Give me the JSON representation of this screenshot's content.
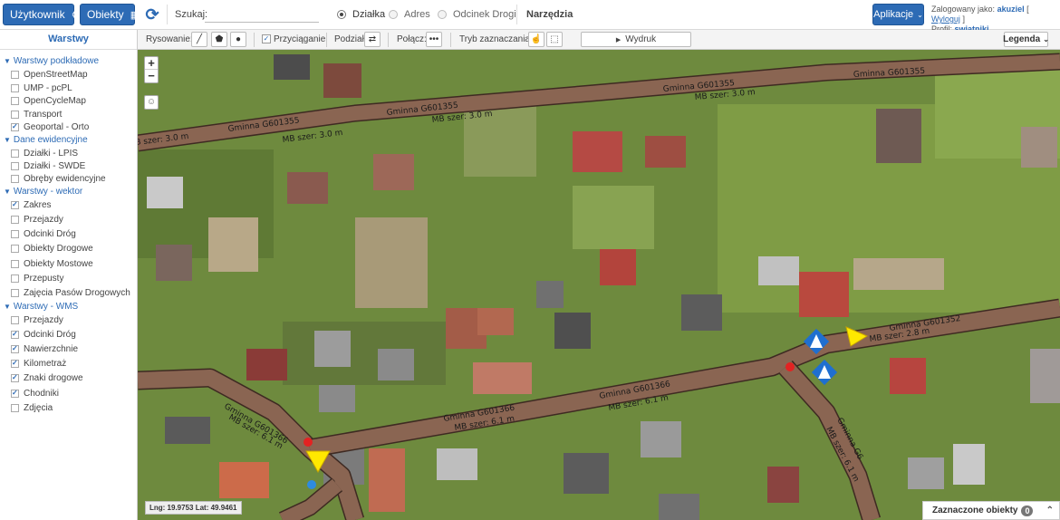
{
  "topbar": {
    "user_button": "Użytkownik",
    "objects_button": "Obiekty",
    "search_label": "Szukaj:",
    "search_value": "",
    "search_placeholder": "",
    "radio_options": [
      "Działka",
      "Adres",
      "Odcinek Drogi"
    ],
    "radio_selected": "Działka",
    "tools_label": "Narzędzia",
    "apps_button": "Aplikacje",
    "logged_in_label": "Zalogowany jako:",
    "username": "akuziel",
    "logout_link": "Wyloguj",
    "profile_label": "Profil:",
    "profile_name": "swiatniki"
  },
  "toolbar": {
    "drawing_label": "Rysowanie:",
    "snapping_label": "Przyciąganie",
    "snapping_checked": true,
    "split_label": "Podział:",
    "join_label": "Połącz:",
    "selection_mode_label": "Tryb zaznaczania:",
    "print_label": "Wydruk",
    "legend_label": "Legenda"
  },
  "sidebar": {
    "title": "Warstwy",
    "groups": [
      {
        "label": "Warstwy podkładowe",
        "items": [
          {
            "label": "OpenStreetMap",
            "checked": false
          },
          {
            "label": "UMP - pcPL",
            "checked": false
          },
          {
            "label": "OpenCycleMap",
            "checked": false
          },
          {
            "label": "Transport",
            "checked": false
          },
          {
            "label": "Geoportal - Orto",
            "checked": true
          }
        ]
      },
      {
        "label": "Dane ewidencyjne",
        "items": [
          {
            "label": "Działki - LPIS",
            "checked": false
          },
          {
            "label": "Działki - SWDE",
            "checked": false
          },
          {
            "label": "Obręby ewidencyjne",
            "checked": false
          }
        ]
      },
      {
        "label": "Warstwy - wektor",
        "items": [
          {
            "label": "Zakres",
            "checked": true
          },
          {
            "label": "Przejazdy",
            "checked": false
          },
          {
            "label": "Odcinki Dróg",
            "checked": false
          },
          {
            "label": "Obiekty Drogowe",
            "checked": false
          },
          {
            "label": "Obiekty Mostowe",
            "checked": false
          },
          {
            "label": "Przepusty",
            "checked": false
          },
          {
            "label": "Zajęcia Pasów Drogowych",
            "checked": false
          }
        ]
      },
      {
        "label": "Warstwy - WMS",
        "items": [
          {
            "label": "Przejazdy",
            "checked": false
          },
          {
            "label": "Odcinki Dróg",
            "checked": true
          },
          {
            "label": "Nawierzchnie",
            "checked": true
          },
          {
            "label": "Kilometraż",
            "checked": true
          },
          {
            "label": "Znaki drogowe",
            "checked": true
          },
          {
            "label": "Chodniki",
            "checked": true
          },
          {
            "label": "Zdjęcia",
            "checked": false
          }
        ]
      }
    ]
  },
  "map": {
    "zoom_in": "+",
    "zoom_out": "−",
    "coordinates": "Lng: 19.9753 Lat: 49.9461",
    "road_labels": {
      "r1_name": "Gminna  G601355",
      "r1_width": "MB szer: 3.0 m",
      "r2_name": "Gminna  G601366",
      "r2_width": "MB szer: 6.1 m",
      "r3_name": "Gminna  G601352",
      "r3_width": "MB szer: 2.8 m",
      "r4_name": "Gminna  G6",
      "r4_width": "MB szer: 6.1 m"
    },
    "selected_objects_label": "Zaznaczone obiekty",
    "selected_objects_count": "0"
  },
  "colors": {
    "accent": "#2d6bb5",
    "road": "#8a6552",
    "sign_red": "#e32222",
    "sign_yellow": "#ffe800"
  }
}
